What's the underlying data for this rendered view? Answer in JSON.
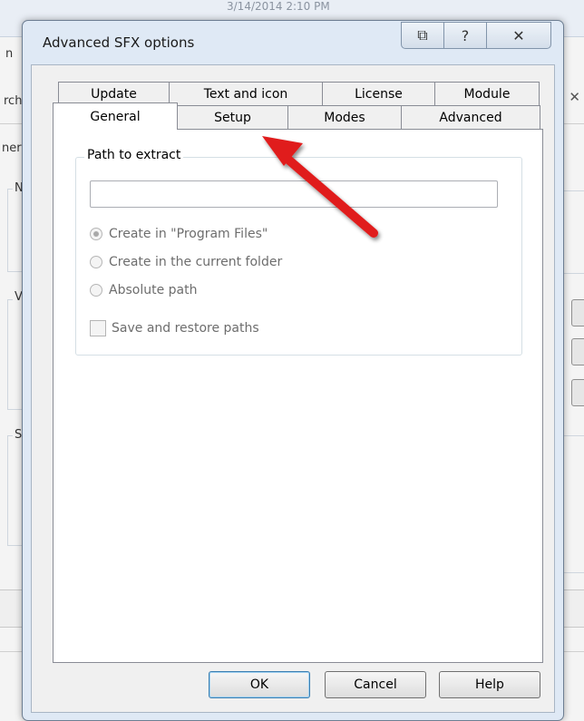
{
  "background_window": {
    "date_fragment": "3/14/2014 2:10 PM",
    "fragment_n": "n",
    "fragment_rch": "rch",
    "fragment_ner": "ner",
    "group_labels": [
      "NT",
      "Vo",
      "Sy"
    ],
    "close_glyph": "✕"
  },
  "dialog": {
    "title": "Advanced SFX options",
    "title_buttons": [
      {
        "name": "restore-icon",
        "glyph": "⧉"
      },
      {
        "name": "help-icon",
        "glyph": "?"
      },
      {
        "name": "close-icon",
        "glyph": "✕"
      }
    ]
  },
  "tabs": {
    "row1": [
      "Update",
      "Text and icon",
      "License",
      "Module"
    ],
    "row2": [
      "General",
      "Setup",
      "Modes",
      "Advanced"
    ],
    "active": "General"
  },
  "general": {
    "group_label": "Path to extract",
    "path_value": "",
    "radios": [
      {
        "label": "Create in \"Program Files\"",
        "checked": true
      },
      {
        "label": "Create in the current folder",
        "checked": false
      },
      {
        "label": "Absolute path",
        "checked": false
      }
    ],
    "checkbox": {
      "label": "Save and restore paths",
      "checked": false
    }
  },
  "buttons": {
    "ok": "OK",
    "cancel": "Cancel",
    "help": "Help"
  },
  "annotation": {
    "arrow_color": "#e01c1c",
    "points_to": "Setup tab"
  }
}
